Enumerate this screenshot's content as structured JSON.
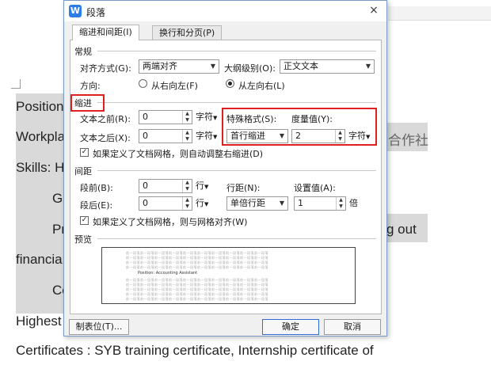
{
  "document": {
    "lines": {
      "position": "Position",
      "workplace": "Workpla",
      "workplace_tail": "合作社",
      "skills": "Skills: H",
      "g": "G",
      "pr": "Pr",
      "pr_tail": "g   out",
      "financial": "financia",
      "co": "Co",
      "highest": "Highest",
      "certificates": "Certificates : SYB training     certificate,    Internship certificate of"
    }
  },
  "dialog": {
    "title": "段落",
    "close": "×",
    "tabs": [
      "缩进和间距(I)",
      "换行和分页(P)"
    ],
    "general": {
      "title": "常规",
      "align_label": "对齐方式(G):",
      "align_value": "两端对齐",
      "outline_label": "大纲级别(O):",
      "outline_value": "正文文本",
      "direction_label": "方向:",
      "rtl": "从右向左(F)",
      "ltr": "从左向右(L)"
    },
    "indent": {
      "title": "缩进",
      "before_label": "文本之前(R):",
      "before_value": "0",
      "before_unit": "字符",
      "after_label": "文本之后(X):",
      "after_value": "0",
      "after_unit": "字符",
      "special_label": "特殊格式(S):",
      "special_value": "首行缩进",
      "measure_label": "度量值(Y):",
      "measure_value": "2",
      "measure_unit": "字符",
      "auto_adjust": "如果定义了文档网格，则自动调整右缩进(D)"
    },
    "spacing": {
      "title": "间距",
      "before_label": "段前(B):",
      "before_value": "0",
      "before_unit": "行",
      "after_label": "段后(E):",
      "after_value": "0",
      "after_unit": "行",
      "line_label": "行距(N):",
      "line_value": "单倍行距",
      "set_label": "设置值(A):",
      "set_value": "1",
      "set_unit": "倍",
      "snap_grid": "如果定义了文档网格，则与网格对齐(W)"
    },
    "preview": {
      "title": "预览",
      "filler": "前一段落前一段落前一段落前一段落前一段落前一段落前一段落前一段落前一段落前一段落",
      "sample": "Position: Accounting Assistant"
    },
    "buttons": {
      "tabs": "制表位(T)...",
      "ok": "确定",
      "cancel": "取消"
    },
    "colors": {
      "highlight": "#e02020",
      "accent": "#2b7de9"
    }
  }
}
